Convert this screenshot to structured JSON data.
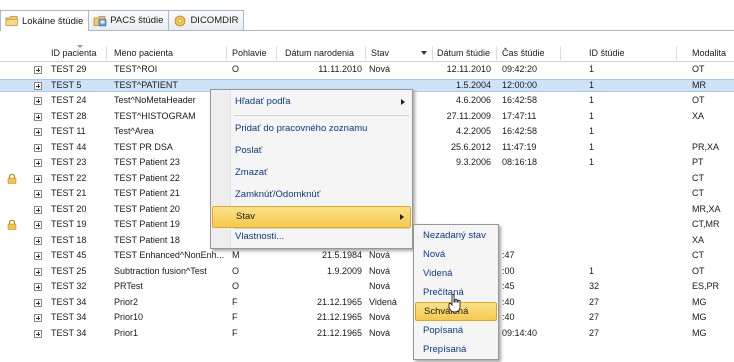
{
  "tabs": [
    {
      "label": "Lokálne štúdie",
      "icon": "folder-icon",
      "active": true
    },
    {
      "label": "PACS štúdie",
      "icon": "pacs-server-icon",
      "active": false
    },
    {
      "label": "DICOMDIR",
      "icon": "dicomdir-icon",
      "active": false
    }
  ],
  "columns": {
    "id": "ID pacienta",
    "name": "Meno pacienta",
    "sex": "Pohlavie",
    "dob": "Dátum narodenia",
    "status": "Stav",
    "study_date": "Dátum štúdie",
    "study_time": "Čas štúdie",
    "study_id": "ID štúdie",
    "modality": "Modalita"
  },
  "rows": [
    {
      "id": "TEST 29",
      "name": "TEST^ROI",
      "sex": "O",
      "dob": "11.11.2010",
      "status": "Nová",
      "study_date": "12.11.2010",
      "study_time": "09:42:20",
      "study_id": "1",
      "modality": "OT",
      "locked": false,
      "selected": false
    },
    {
      "id": "TEST 5",
      "name": "TEST^PATIENT",
      "sex": "",
      "dob": "",
      "status": "",
      "study_date": "1.5.2004",
      "study_time": "12:00:00",
      "study_id": "1",
      "modality": "MR",
      "locked": false,
      "selected": true
    },
    {
      "id": "TEST 24",
      "name": "Test^NoMetaHeader",
      "sex": "",
      "dob": "",
      "status": "",
      "study_date": "4.6.2006",
      "study_time": "16:42:58",
      "study_id": "1",
      "modality": "OT",
      "locked": false,
      "selected": false
    },
    {
      "id": "TEST 28",
      "name": "TEST^HISTOGRAM",
      "sex": "",
      "dob": "",
      "status": "",
      "study_date": "27.11.2009",
      "study_time": "17:47:11",
      "study_id": "1",
      "modality": "XA",
      "locked": false,
      "selected": false
    },
    {
      "id": "TEST 11",
      "name": "Test^Area",
      "sex": "",
      "dob": "",
      "status": "",
      "study_date": "4.2.2005",
      "study_time": "16:42:58",
      "study_id": "1",
      "modality": "",
      "locked": false,
      "selected": false
    },
    {
      "id": "TEST 44",
      "name": "TEST PR DSA",
      "sex": "",
      "dob": "",
      "status": "",
      "study_date": "25.6.2012",
      "study_time": "11:47:19",
      "study_id": "1",
      "modality": "PR,XA",
      "locked": false,
      "selected": false
    },
    {
      "id": "TEST 23",
      "name": "TEST Patient 23",
      "sex": "",
      "dob": "",
      "status": "",
      "study_date": "9.3.2006",
      "study_time": "08:16:18",
      "study_id": "1",
      "modality": "PT",
      "locked": false,
      "selected": false
    },
    {
      "id": "TEST 22",
      "name": "TEST Patient 22",
      "sex": "",
      "dob": "",
      "status": "",
      "study_date": "",
      "study_time": "",
      "study_id": "",
      "modality": "CT",
      "locked": true,
      "selected": false
    },
    {
      "id": "TEST 21",
      "name": "TEST Patient 21",
      "sex": "",
      "dob": "",
      "status": "",
      "study_date": "",
      "study_time": "",
      "study_id": "",
      "modality": "CT",
      "locked": false,
      "selected": false
    },
    {
      "id": "TEST 20",
      "name": "TEST Patient 20",
      "sex": "",
      "dob": "",
      "status": "",
      "study_date": "",
      "study_time": "",
      "study_id": "",
      "modality": "MR,XA",
      "locked": false,
      "selected": false
    },
    {
      "id": "TEST 19",
      "name": "TEST Patient 19",
      "sex": "",
      "dob": "",
      "status": "",
      "study_date": "",
      "study_time": "",
      "study_id": "",
      "modality": "CT,MR",
      "locked": true,
      "selected": false
    },
    {
      "id": "TEST 18",
      "name": "TEST Patient 18",
      "sex": "",
      "dob": "",
      "status": "Nová",
      "study_date": "",
      "study_time": "",
      "study_id": "",
      "modality": "XA",
      "locked": false,
      "selected": false
    },
    {
      "id": "TEST 45",
      "name": "TEST Enhanced^NonEnh...",
      "sex": "M",
      "dob": "21.5.1984",
      "status": "Nová",
      "study_date": "",
      "study_time": ":47",
      "study_id": "",
      "modality": "CT",
      "locked": false,
      "selected": false
    },
    {
      "id": "TEST 25",
      "name": "Subtraction fusion^Test",
      "sex": "O",
      "dob": "1.9.2009",
      "status": "Nová",
      "study_date": "",
      "study_time": ":00",
      "study_id": "1",
      "modality": "OT",
      "locked": false,
      "selected": false
    },
    {
      "id": "TEST 32",
      "name": "PRTest",
      "sex": "O",
      "dob": "",
      "status": "Nová",
      "study_date": "",
      "study_time": ":45",
      "study_id": "32",
      "modality": "ES,PR",
      "locked": false,
      "selected": false
    },
    {
      "id": "TEST 34",
      "name": "Prior2",
      "sex": "F",
      "dob": "21.12.1965",
      "status": "Videná",
      "study_date": "",
      "study_time": ":40",
      "study_id": "27",
      "modality": "MG",
      "locked": false,
      "selected": false
    },
    {
      "id": "TEST 34",
      "name": "Prior10",
      "sex": "F",
      "dob": "21.12.1965",
      "status": "Nová",
      "study_date": "",
      "study_time": ":40",
      "study_id": "27",
      "modality": "MG",
      "locked": false,
      "selected": false
    },
    {
      "id": "TEST 34",
      "name": "Prior1",
      "sex": "F",
      "dob": "21.12.1965",
      "status": "Nová",
      "study_date": "1.10.2010",
      "study_time": "09:14:40",
      "study_id": "27",
      "modality": "MG",
      "locked": false,
      "selected": false
    }
  ],
  "context_menu": {
    "items": [
      {
        "label": "Hľadať podľa",
        "submenu": true
      },
      {
        "label": "Pridať do pracovného zoznamu",
        "submenu": false
      },
      {
        "label": "Poslať",
        "submenu": false
      },
      {
        "label": "Zmazať",
        "submenu": false
      },
      {
        "label": "Zamknúť/Odomknúť",
        "submenu": false
      },
      {
        "label": "Stav",
        "submenu": true,
        "active": true
      },
      {
        "label": "Vlastnosti...",
        "submenu": false
      }
    ]
  },
  "status_submenu": {
    "items": [
      {
        "label": "Nezadaný stav",
        "active": false
      },
      {
        "label": "Nová",
        "active": false
      },
      {
        "label": "Videná",
        "active": false
      },
      {
        "label": "Prečítaná",
        "active": false
      },
      {
        "label": "Schválená",
        "active": true
      },
      {
        "label": "Popísaná",
        "active": false
      },
      {
        "label": "Prepísaná",
        "active": false
      }
    ]
  },
  "colors": {
    "selected_row": "#cfe3f8",
    "menu_highlight": "#f6c94a",
    "menu_text": "#0b3a86"
  }
}
